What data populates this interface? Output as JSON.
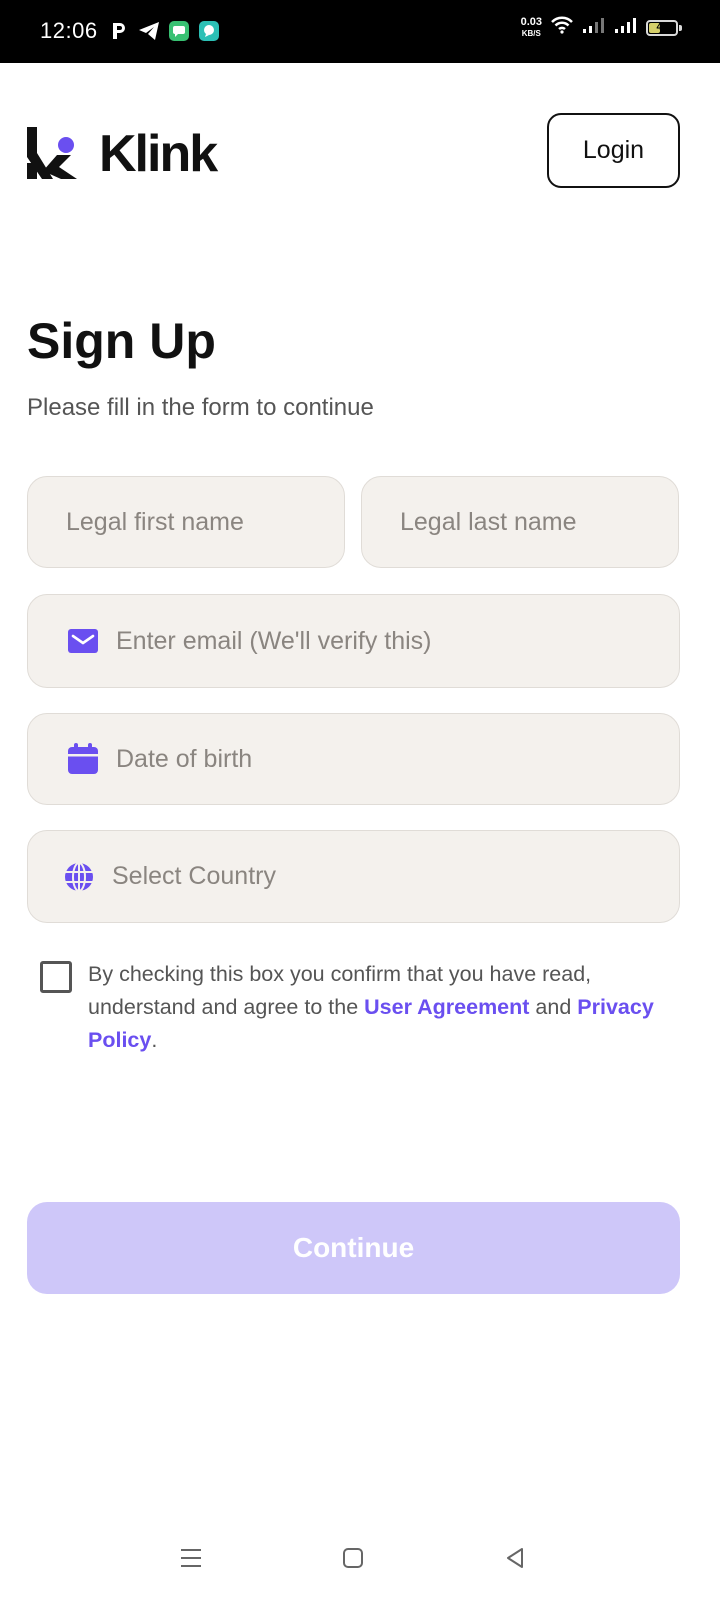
{
  "status_bar": {
    "time": "12:06",
    "net_speed": "0.03",
    "net_unit": "KB/S",
    "battery": "40",
    "notification_icons": [
      "p-icon",
      "telegram-icon",
      "messages-icon",
      "chat-icon"
    ]
  },
  "header": {
    "brand": "Klink",
    "login_label": "Login"
  },
  "form": {
    "title": "Sign Up",
    "subtitle": "Please fill in the form to continue",
    "first_name_placeholder": "Legal first name",
    "last_name_placeholder": "Legal last name",
    "email_placeholder": "Enter email (We'll verify this)",
    "dob_placeholder": "Date of birth",
    "country_placeholder": "Select Country",
    "agreement_text_1": "By checking this box you confirm that you have read, understand and agree to the ",
    "user_agreement_link": "User Agreement",
    "agreement_text_2": " and ",
    "privacy_policy_link": "Privacy Policy",
    "agreement_text_3": ".",
    "continue_label": "Continue"
  },
  "colors": {
    "accent": "#6a4ff0",
    "accent_disabled": "#cec7f9",
    "field_bg": "#f4f1ed",
    "text": "#111111"
  }
}
